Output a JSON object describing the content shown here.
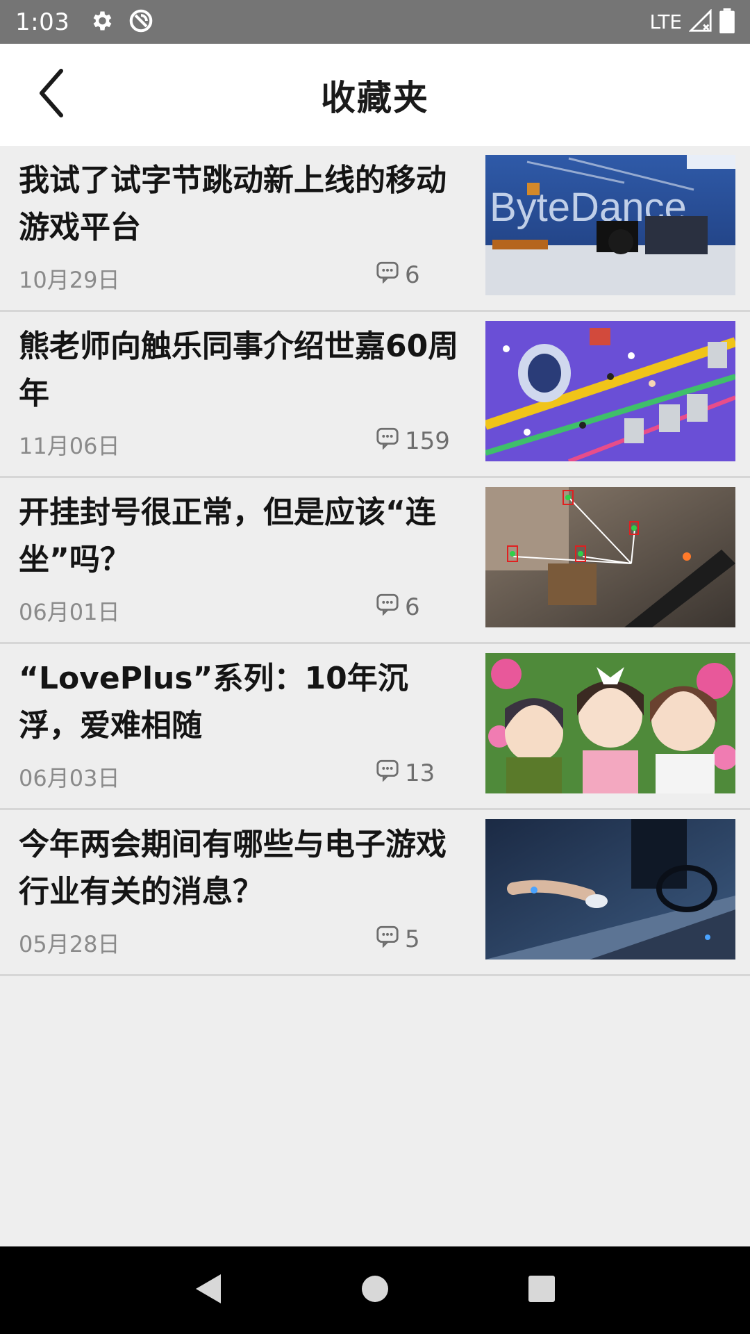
{
  "status_bar": {
    "time": "1:03",
    "network": "LTE",
    "icons": [
      "gear-icon",
      "data-saver-icon",
      "signal-icon",
      "battery-icon"
    ]
  },
  "header": {
    "title": "收藏夹",
    "back_icon": "back-arrow-icon"
  },
  "articles": [
    {
      "title": "我试了试字节跳动新上线的移动游戏平台",
      "date": "10月29日",
      "comments": "6",
      "thumb_text": "ByteDance"
    },
    {
      "title": "熊老师向触乐同事介绍世嘉60周年",
      "date": "11月06日",
      "comments": "159"
    },
    {
      "title": "开挂封号很正常，但是应该“连坐”吗？",
      "date": "06月01日",
      "comments": "6"
    },
    {
      "title": "“LovePlus”系列：10年沉浮，爱难相随",
      "date": "06月03日",
      "comments": "13"
    },
    {
      "title": "今年两会期间有哪些与电子游戏行业有关的消息？",
      "date": "05月28日",
      "comments": "5"
    }
  ],
  "colors": {
    "status_bar": "#757575",
    "app_bar": "#ffffff",
    "background": "#eeeeee",
    "title_text": "#141414",
    "meta_text": "#8a8a8a",
    "nav_bar": "#000000"
  },
  "nav": {
    "icons": [
      "nav-back-icon",
      "nav-home-icon",
      "nav-recents-icon"
    ]
  }
}
